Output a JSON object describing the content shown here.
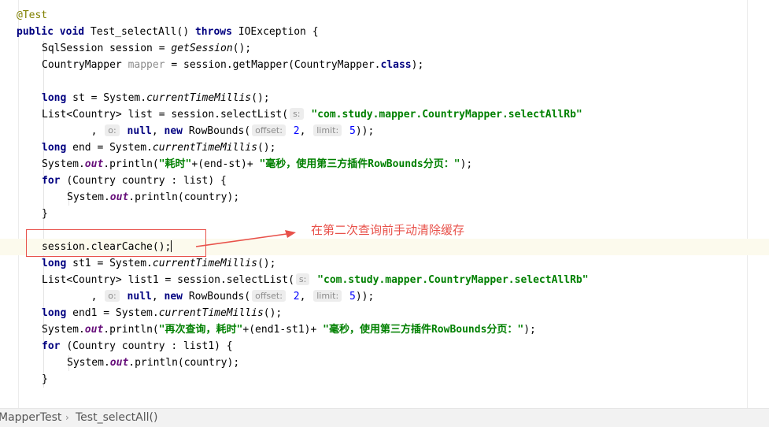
{
  "editor": {
    "lines": [
      {
        "id": "l1",
        "tokens": [
          {
            "t": "@Test",
            "c": "ann"
          }
        ]
      },
      {
        "id": "l2",
        "tokens": [
          {
            "t": "public void ",
            "c": "kw"
          },
          {
            "t": "Test_selectAll() "
          },
          {
            "t": "throws ",
            "c": "kw"
          },
          {
            "t": "IOException {"
          }
        ]
      },
      {
        "id": "l3",
        "tokens": [
          {
            "t": "SqlSession session = "
          },
          {
            "t": "getSession",
            "c": "ital"
          },
          {
            "t": "();"
          }
        ]
      },
      {
        "id": "l4",
        "tokens": [
          {
            "t": "CountryMapper "
          },
          {
            "t": "mapper",
            "c": "unused"
          },
          {
            "t": " = session.getMapper(CountryMapper."
          },
          {
            "t": "class",
            "c": "kw"
          },
          {
            "t": ");"
          }
        ]
      },
      {
        "id": "l5",
        "tokens": []
      },
      {
        "id": "l6",
        "tokens": [
          {
            "t": "long ",
            "c": "kw"
          },
          {
            "t": "st = System."
          },
          {
            "t": "currentTimeMillis",
            "c": "ital"
          },
          {
            "t": "();"
          }
        ]
      },
      {
        "id": "l7",
        "tokens": [
          {
            "t": "List<Country> list = session.selectList("
          },
          {
            "t": "s:",
            "c": "hint"
          },
          {
            "t": " "
          },
          {
            "t": "\"com.study.mapper.CountryMapper.selectAllRb\"",
            "c": "str"
          }
        ]
      },
      {
        "id": "l8",
        "tokens": [
          {
            "t": "        , "
          },
          {
            "t": "o:",
            "c": "hint"
          },
          {
            "t": " "
          },
          {
            "t": "null",
            "c": "kw"
          },
          {
            "t": ", "
          },
          {
            "t": "new ",
            "c": "kw"
          },
          {
            "t": "RowBounds("
          },
          {
            "t": "offset:",
            "c": "hint"
          },
          {
            "t": " "
          },
          {
            "t": "2",
            "c": "num"
          },
          {
            "t": ", "
          },
          {
            "t": "limit:",
            "c": "hint"
          },
          {
            "t": " "
          },
          {
            "t": "5",
            "c": "num"
          },
          {
            "t": "));"
          }
        ]
      },
      {
        "id": "l9",
        "tokens": [
          {
            "t": "long ",
            "c": "kw"
          },
          {
            "t": "end = System."
          },
          {
            "t": "currentTimeMillis",
            "c": "ital"
          },
          {
            "t": "();"
          }
        ]
      },
      {
        "id": "l10",
        "tokens": [
          {
            "t": "System."
          },
          {
            "t": "out",
            "c": "field"
          },
          {
            "t": ".println("
          },
          {
            "t": "\"耗时\"",
            "c": "str"
          },
          {
            "t": "+(end-st)+ "
          },
          {
            "t": "\"毫秒，使用第三方插件RowBounds分页：\"",
            "c": "str"
          },
          {
            "t": ");"
          }
        ]
      },
      {
        "id": "l11",
        "tokens": [
          {
            "t": "for ",
            "c": "kw"
          },
          {
            "t": "(Country country : list) {"
          }
        ]
      },
      {
        "id": "l12",
        "tokens": [
          {
            "t": "System."
          },
          {
            "t": "out",
            "c": "field"
          },
          {
            "t": ".println(country);"
          }
        ]
      },
      {
        "id": "l13",
        "tokens": [
          {
            "t": "}"
          }
        ]
      },
      {
        "id": "l14",
        "tokens": []
      },
      {
        "id": "l15",
        "tokens": [
          {
            "t": "session.clearCache();"
          },
          {
            "t": "",
            "c": "caret"
          }
        ]
      },
      {
        "id": "l16",
        "tokens": [
          {
            "t": "long ",
            "c": "kw"
          },
          {
            "t": "st1 = System."
          },
          {
            "t": "currentTimeMillis",
            "c": "ital"
          },
          {
            "t": "();"
          }
        ]
      },
      {
        "id": "l17",
        "tokens": [
          {
            "t": "List<Country> list1 = session.selectList("
          },
          {
            "t": "s:",
            "c": "hint"
          },
          {
            "t": " "
          },
          {
            "t": "\"com.study.mapper.CountryMapper.selectAllRb\"",
            "c": "str"
          }
        ]
      },
      {
        "id": "l18",
        "tokens": [
          {
            "t": "        , "
          },
          {
            "t": "o:",
            "c": "hint"
          },
          {
            "t": " "
          },
          {
            "t": "null",
            "c": "kw"
          },
          {
            "t": ", "
          },
          {
            "t": "new ",
            "c": "kw"
          },
          {
            "t": "RowBounds("
          },
          {
            "t": "offset:",
            "c": "hint"
          },
          {
            "t": " "
          },
          {
            "t": "2",
            "c": "num"
          },
          {
            "t": ", "
          },
          {
            "t": "limit:",
            "c": "hint"
          },
          {
            "t": " "
          },
          {
            "t": "5",
            "c": "num"
          },
          {
            "t": "));"
          }
        ]
      },
      {
        "id": "l19",
        "tokens": [
          {
            "t": "long ",
            "c": "kw"
          },
          {
            "t": "end1 = System."
          },
          {
            "t": "currentTimeMillis",
            "c": "ital"
          },
          {
            "t": "();"
          }
        ]
      },
      {
        "id": "l20",
        "tokens": [
          {
            "t": "System."
          },
          {
            "t": "out",
            "c": "field"
          },
          {
            "t": ".println("
          },
          {
            "t": "\"再次查询，耗时\"",
            "c": "str"
          },
          {
            "t": "+(end1-st1)+ "
          },
          {
            "t": "\"毫秒，使用第三方插件RowBounds分页：\"",
            "c": "str"
          },
          {
            "t": ");"
          }
        ]
      },
      {
        "id": "l21",
        "tokens": [
          {
            "t": "for ",
            "c": "kw"
          },
          {
            "t": "(Country country : list1) {"
          }
        ]
      },
      {
        "id": "l22",
        "tokens": [
          {
            "t": "System."
          },
          {
            "t": "out",
            "c": "field"
          },
          {
            "t": ".println(country);"
          }
        ]
      },
      {
        "id": "l23",
        "tokens": [
          {
            "t": "}"
          }
        ]
      }
    ]
  },
  "annotation": {
    "text": "在第二次查询前手动清除缓存",
    "color": "#e8514a"
  },
  "breadcrumb": {
    "items": [
      "MapperTest",
      "Test_selectAll()"
    ],
    "separator": "›"
  },
  "colors": {
    "keyword": "#000080",
    "string": "#008000",
    "annotation": "#808000",
    "number": "#0000ff",
    "current_line": "#fcfaed"
  }
}
